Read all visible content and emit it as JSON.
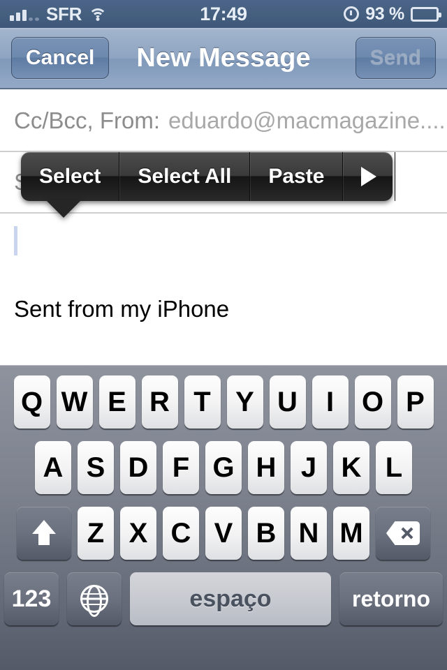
{
  "status_bar": {
    "carrier": "SFR",
    "time": "17:49",
    "battery_percent": "93 %",
    "signal_icon": "signal-bars-icon",
    "wifi_icon": "wifi-icon",
    "clock_icon": "alarm-clock-icon",
    "battery_icon": "battery-icon",
    "battery_level": 93
  },
  "nav_bar": {
    "cancel_label": "Cancel",
    "title": "New Message",
    "send_label": "Send",
    "send_disabled": true
  },
  "compose": {
    "cc_bcc_label": "Cc/Bcc, From:",
    "cc_bcc_value": "eduardo@macmagazine....",
    "subject_label": "S",
    "body_signature": "Sent from my iPhone"
  },
  "edit_menu": {
    "items": [
      {
        "label": "Select",
        "icon": ""
      },
      {
        "label": "Select All",
        "icon": ""
      },
      {
        "label": "Paste",
        "icon": ""
      },
      {
        "label": "",
        "icon": "arrow-right-icon"
      }
    ]
  },
  "keyboard": {
    "language": "Portuguese",
    "row1": [
      "Q",
      "W",
      "E",
      "R",
      "T",
      "Y",
      "U",
      "I",
      "O",
      "P"
    ],
    "row2": [
      "A",
      "S",
      "D",
      "F",
      "G",
      "H",
      "J",
      "K",
      "L"
    ],
    "row3": [
      "Z",
      "X",
      "C",
      "V",
      "B",
      "N",
      "M"
    ],
    "shift_icon": "shift-arrow-icon",
    "delete_icon": "delete-backspace-icon",
    "numbers_label": "123",
    "globe_icon": "globe-icon",
    "space_label": "espaço",
    "return_label": "retorno"
  },
  "colors": {
    "status_bar": "#46607f",
    "nav_bar": "#8ea4c1",
    "accent_button": "#6d89ae",
    "edit_menu": "#2a2a2a",
    "keyboard_bg": "#7d828e",
    "key_light": "#f3f3f4",
    "key_dark": "#6a707d",
    "caret": "#c9d5ee"
  }
}
